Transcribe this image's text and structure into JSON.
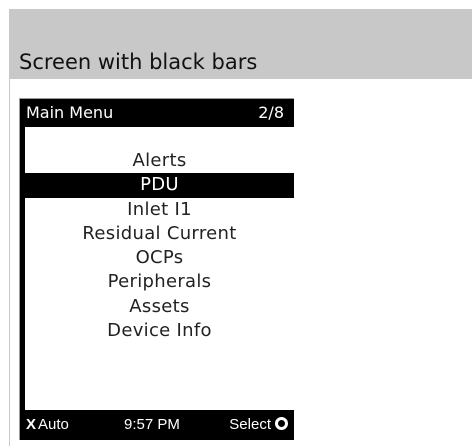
{
  "header": {
    "title": "Screen with black bars",
    "background": "#c8c8c8"
  },
  "lcd": {
    "top_bar": {
      "menu_title": "Main  Menu",
      "page_indicator": "2/8"
    },
    "menu": {
      "items": [
        {
          "label": "Alerts",
          "selected": false
        },
        {
          "label": "PDU",
          "selected": true
        },
        {
          "label": "Inlet  I1",
          "selected": false
        },
        {
          "label": "Residual Current",
          "selected": false
        },
        {
          "label": "OCPs",
          "selected": false
        },
        {
          "label": "Peripherals",
          "selected": false
        },
        {
          "label": "Assets",
          "selected": false
        },
        {
          "label": "Device Info",
          "selected": false
        }
      ]
    },
    "bottom_bar": {
      "left_softkey_glyph": "X",
      "left_softkey_label": "Auto",
      "left_softkey_icon": "x-icon",
      "clock": "9:57 PM",
      "right_softkey_label": "Select",
      "right_softkey_icon": "circle-icon"
    },
    "colors": {
      "bar": "#000000",
      "text_on_bar": "#ffffff",
      "body": "#ffffff",
      "selection": "#000000"
    }
  }
}
